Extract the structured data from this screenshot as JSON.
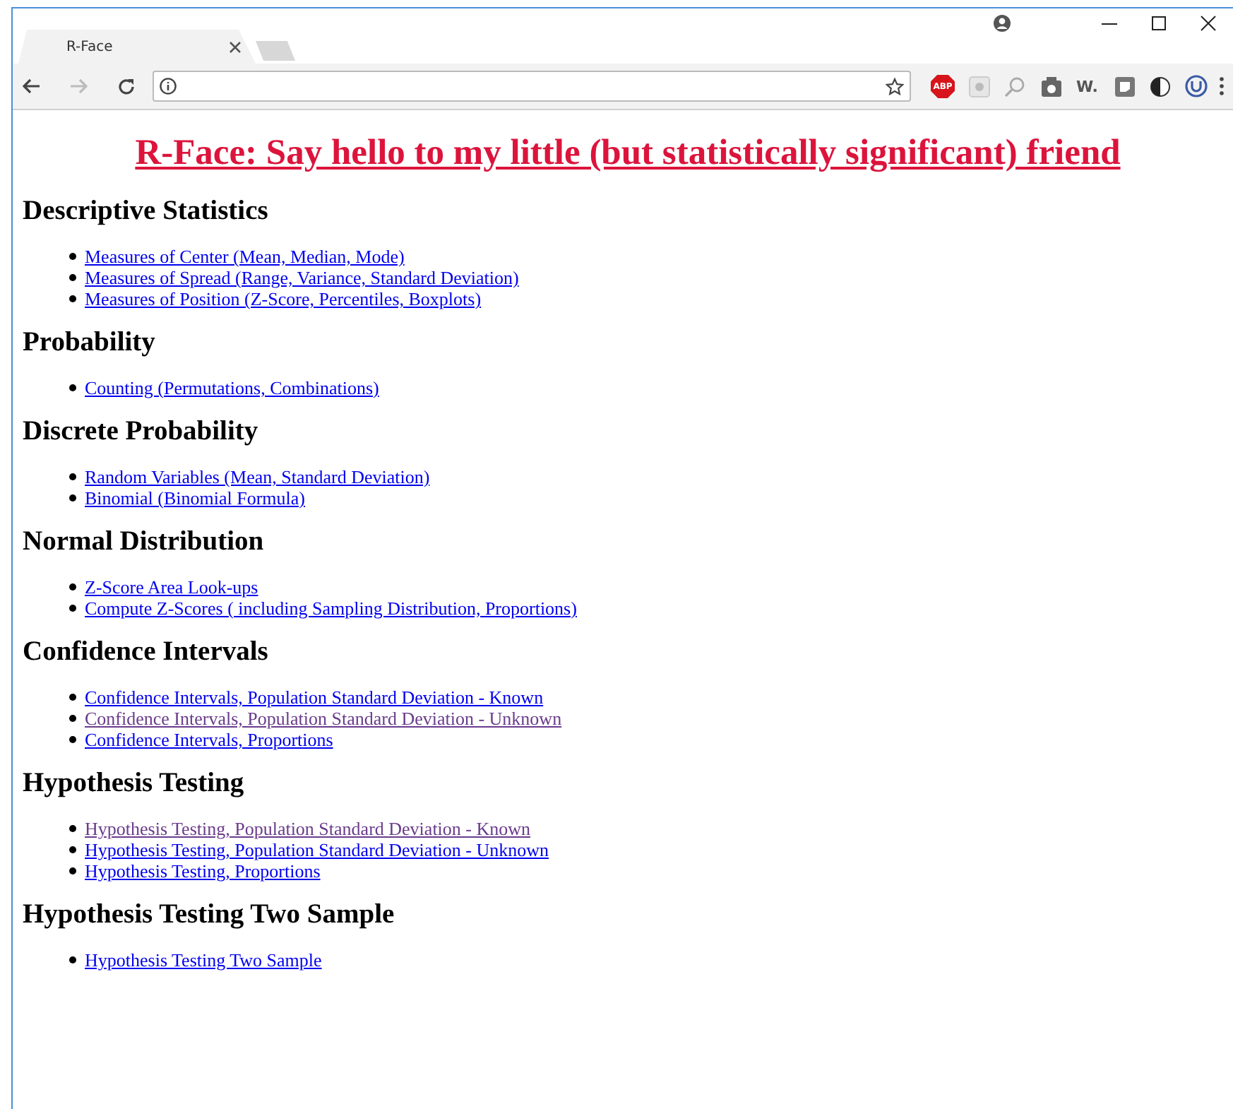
{
  "browser": {
    "tabs": [
      {
        "title": "R-Face",
        "selected": true
      }
    ],
    "extensions": [
      {
        "kind": "abp",
        "label": "ABP"
      },
      {
        "kind": "record"
      },
      {
        "kind": "lens"
      },
      {
        "kind": "camera"
      },
      {
        "kind": "wordmark",
        "label": "W."
      },
      {
        "kind": "square"
      },
      {
        "kind": "contrast"
      },
      {
        "kind": "ublock"
      }
    ]
  },
  "page": {
    "title": "R-Face: Say hello to my little (but statistically significant) friend",
    "sections": [
      {
        "heading": "Descriptive Statistics",
        "links": [
          {
            "text": "Measures of Center (Mean, Median, Mode)",
            "visited": false
          },
          {
            "text": "Measures of Spread (Range, Variance, Standard Deviation)",
            "visited": false
          },
          {
            "text": "Measures of Position (Z-Score, Percentiles, Boxplots)",
            "visited": false
          }
        ]
      },
      {
        "heading": "Probability",
        "links": [
          {
            "text": "Counting (Permutations, Combinations)",
            "visited": false
          }
        ]
      },
      {
        "heading": "Discrete Probability",
        "links": [
          {
            "text": "Random Variables (Mean, Standard Deviation)",
            "visited": false
          },
          {
            "text": "Binomial (Binomial Formula)",
            "visited": false
          }
        ]
      },
      {
        "heading": "Normal Distribution",
        "links": [
          {
            "text": "Z-Score Area Look-ups",
            "visited": false
          },
          {
            "text": "Compute Z-Scores ( including Sampling Distribution, Proportions)",
            "visited": false
          }
        ]
      },
      {
        "heading": "Confidence Intervals",
        "links": [
          {
            "text": "Confidence Intervals, Population Standard Deviation - Known",
            "visited": false
          },
          {
            "text": "Confidence Intervals, Population Standard Deviation - Unknown",
            "visited": true
          },
          {
            "text": "Confidence Intervals, Proportions",
            "visited": false
          }
        ]
      },
      {
        "heading": "Hypothesis Testing",
        "links": [
          {
            "text": "Hypothesis Testing, Population Standard Deviation - Known",
            "visited": true
          },
          {
            "text": "Hypothesis Testing, Population Standard Deviation - Unknown",
            "visited": false
          },
          {
            "text": "Hypothesis Testing, Proportions",
            "visited": false
          }
        ]
      },
      {
        "heading": "Hypothesis Testing Two Sample",
        "links": [
          {
            "text": "Hypothesis Testing Two Sample",
            "visited": false
          }
        ]
      }
    ]
  }
}
